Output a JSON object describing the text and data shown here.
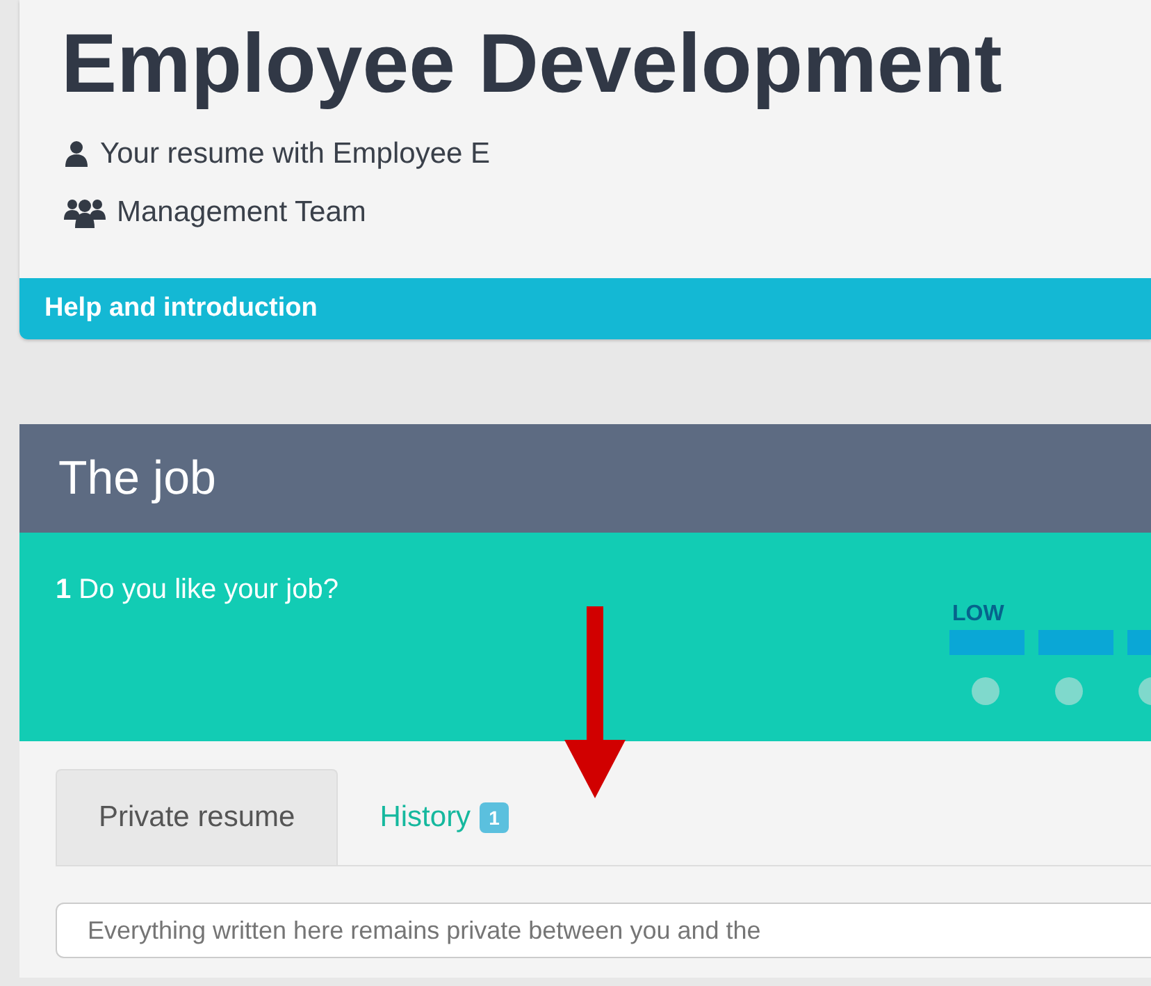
{
  "header": {
    "title": "Employee Development",
    "meta": [
      {
        "kind": "person",
        "text": "Your resume with Employee E"
      },
      {
        "kind": "group",
        "text": "Management Team"
      }
    ],
    "help_bar": "Help and introduction"
  },
  "section": {
    "title": "The job",
    "question": {
      "number": "1",
      "text": "Do you like your job?",
      "scale_label": "LOW",
      "options": [
        {
          "selected": false
        },
        {
          "selected": false
        },
        {
          "selected": false
        }
      ]
    }
  },
  "tabs": [
    {
      "label": "Private resume",
      "selected": true
    },
    {
      "label": "History",
      "badge": "1",
      "selected": false
    }
  ],
  "note_field": {
    "placeholder": "Everything written here remains private between you and the"
  }
}
